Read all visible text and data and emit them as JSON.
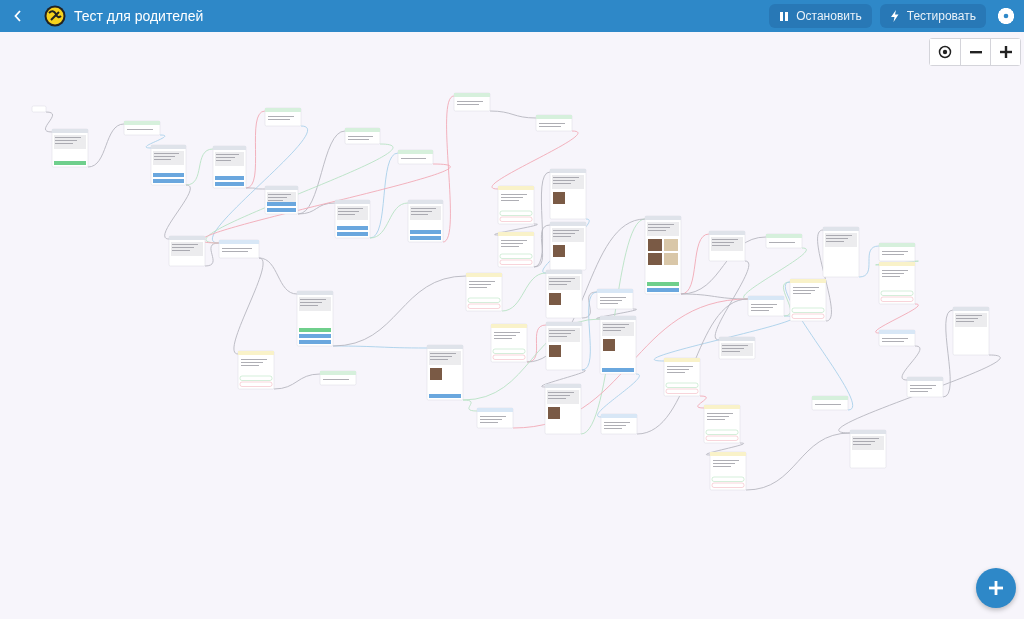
{
  "header": {
    "title": "Тест для родителей",
    "buttons": [
      {
        "kind": "pause",
        "label": "Остановить"
      },
      {
        "kind": "bolt",
        "label": "Тестировать"
      }
    ]
  },
  "canvas": {
    "kind": "flow-diagram"
  },
  "zoom_controls": [
    {
      "kind": "center"
    },
    {
      "kind": "minus"
    },
    {
      "kind": "plus"
    }
  ],
  "add_button": {
    "kind": "plus"
  }
}
